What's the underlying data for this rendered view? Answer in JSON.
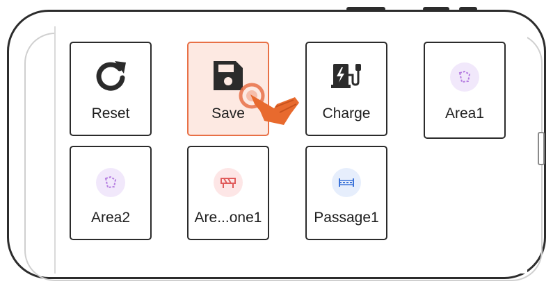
{
  "tiles": [
    {
      "id": "reset",
      "label": "Reset",
      "icon": "refresh-icon"
    },
    {
      "id": "save",
      "label": "Save",
      "icon": "save-icon",
      "state": "active"
    },
    {
      "id": "charge",
      "label": "Charge",
      "icon": "charger-icon"
    },
    {
      "id": "area1",
      "label": "Area1",
      "icon": "area-icon"
    },
    {
      "id": "area2",
      "label": "Area2",
      "icon": "area-icon"
    },
    {
      "id": "area-zone1",
      "label": "Are...one1",
      "icon": "barrier-icon"
    },
    {
      "id": "passage1",
      "label": "Passage1",
      "icon": "passage-icon"
    }
  ],
  "colors": {
    "accent": "#e87046",
    "active_bg": "#fde9e2",
    "tile_border": "#2b2b2b",
    "area_icon_bg": "#f1e8fb",
    "area_icon": "#b47be0",
    "barrier_icon_bg": "#fde6e6",
    "barrier_icon": "#e05b5b",
    "passage_icon_bg": "#e6eefc",
    "passage_icon": "#3c74d9"
  }
}
